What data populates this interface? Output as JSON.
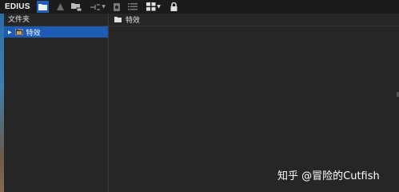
{
  "app": {
    "brand": "EDIUS"
  },
  "toolbar": {
    "buttons": [
      {
        "icon": "folder-icon",
        "active": true
      },
      {
        "icon": "up-triangle-icon"
      },
      {
        "icon": "folder-network-icon"
      },
      {
        "icon": "connect-dropdown-icon"
      },
      {
        "icon": "bin-icon"
      },
      {
        "icon": "list-view-icon"
      },
      {
        "icon": "grid-view-icon"
      },
      {
        "icon": "lock-icon"
      }
    ]
  },
  "folder_panel": {
    "header": "文件夹",
    "items": [
      {
        "label": "特效",
        "selected": true,
        "expanded": false
      }
    ]
  },
  "content_panel": {
    "path_label": "特效"
  },
  "watermark": "知乎 @冒险的Cutfish",
  "colors": {
    "selection": "#1d5bb5",
    "toolbar": "#1b1b1b",
    "panel": "#262626"
  }
}
